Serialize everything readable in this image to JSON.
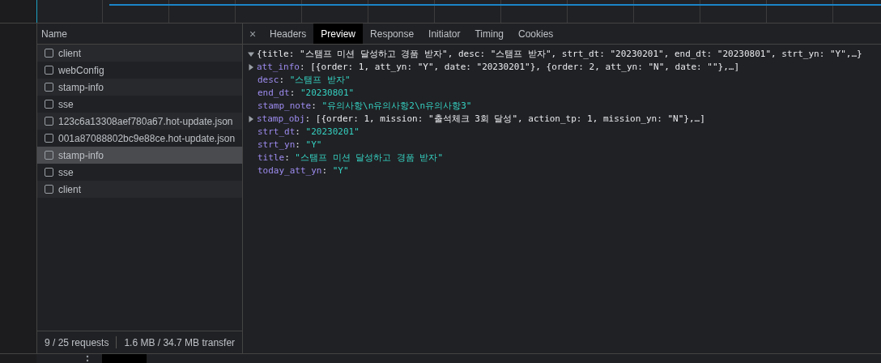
{
  "requests": {
    "header": "Name",
    "rows": [
      {
        "name": "client",
        "selected": false
      },
      {
        "name": "webConfig",
        "selected": false
      },
      {
        "name": "stamp-info",
        "selected": false
      },
      {
        "name": "sse",
        "selected": false
      },
      {
        "name": "123c6a13308aef780a67.hot-update.json",
        "selected": false
      },
      {
        "name": "001a87088802bc9e88ce.hot-update.json",
        "selected": false
      },
      {
        "name": "stamp-info",
        "selected": true
      },
      {
        "name": "sse",
        "selected": false
      },
      {
        "name": "client",
        "selected": false
      }
    ],
    "status": [
      "9 / 25 requests",
      "1.6 MB / 34.7 MB transfer"
    ]
  },
  "detail": {
    "close": "×",
    "tabs": [
      {
        "label": "Headers",
        "selected": false
      },
      {
        "label": "Preview",
        "selected": true
      },
      {
        "label": "Response",
        "selected": false
      },
      {
        "label": "Initiator",
        "selected": false
      },
      {
        "label": "Timing",
        "selected": false
      },
      {
        "label": "Cookies",
        "selected": false
      }
    ],
    "preview": {
      "separator": ":",
      "summary": "{title: \"스탬프 미션 달성하고 경품 받자\", desc: \"스탬프 받자\", strt_dt: \"20230201\", end_dt: \"20230801\", strt_yn: \"Y\",…}",
      "expanded": true,
      "properties": [
        {
          "key": "att_info",
          "kind": "object",
          "expanded": false,
          "value": "[{order: 1, att_yn: \"Y\", date: \"20230201\"}, {order: 2, att_yn: \"N\", date: \"\"},…]"
        },
        {
          "key": "desc",
          "kind": "string",
          "value": "\"스탬프 받자\""
        },
        {
          "key": "end_dt",
          "kind": "string",
          "value": "\"20230801\""
        },
        {
          "key": "stamp_note",
          "kind": "string",
          "value": "\"유의사항\\n유의사항2\\n유의사항3\""
        },
        {
          "key": "stamp_obj",
          "kind": "object",
          "expanded": false,
          "value": "[{order: 1, mission: \"출석체크 3회 달성\", action_tp: 1, mission_yn: \"N\"},…]"
        },
        {
          "key": "strt_dt",
          "kind": "string",
          "value": "\"20230201\""
        },
        {
          "key": "strt_yn",
          "kind": "string",
          "value": "\"Y\""
        },
        {
          "key": "title",
          "kind": "string",
          "value": "\"스탬프 미션 달성하고 경품 받자\""
        },
        {
          "key": "today_att_yn",
          "kind": "string",
          "value": "\"Y\""
        }
      ]
    }
  }
}
